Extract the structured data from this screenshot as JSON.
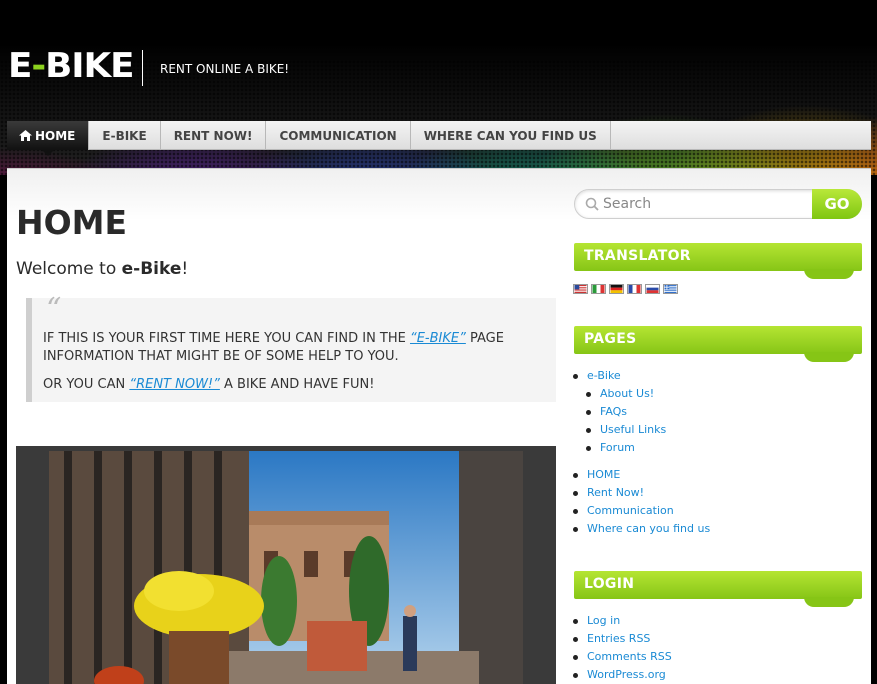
{
  "site": {
    "logo_part1": "E",
    "logo_dash": "-",
    "logo_part2": "BIKE",
    "tagline": "RENT ONLINE A BIKE!"
  },
  "nav": {
    "items": [
      {
        "label": "HOME",
        "active": true
      },
      {
        "label": "E-BIKE"
      },
      {
        "label": "RENT NOW!"
      },
      {
        "label": "COMMUNICATION"
      },
      {
        "label": "WHERE CAN YOU FIND US"
      }
    ]
  },
  "main": {
    "title": "HOME",
    "welcome_prefix": "Welcome to ",
    "welcome_brand": "e-Bike",
    "welcome_suffix": "!",
    "quote_mark": "“",
    "quote_p1_before": "IF THIS IS YOUR FIRST TIME HERE YOU CAN FIND IN THE ",
    "quote_p1_link": "“E-BIKE”",
    "quote_p1_after": " PAGE INFORMATION THAT MIGHT BE OF SOME HELP TO YOU.",
    "quote_p2_before": "OR YOU CAN ",
    "quote_p2_link": "“RENT NOW!”",
    "quote_p2_after": " A BIKE AND HAVE FUN!"
  },
  "sidebar": {
    "search_placeholder": "Search",
    "go_label": "GO",
    "translator_title": "TRANSLATOR",
    "pages_title": "PAGES",
    "pages": {
      "ebike": "e-Bike",
      "about": "About Us!",
      "faqs": "FAQs",
      "useful": "Useful Links",
      "forum": "Forum",
      "home": "HOME",
      "rent": "Rent Now!",
      "communication": "Communication",
      "where": "Where can you find us"
    },
    "login_title": "LOGIN",
    "login_links": {
      "login": "Log in",
      "entries": "Entries RSS",
      "comments": "Comments RSS",
      "wordpress": "WordPress.org"
    }
  },
  "colors": {
    "accent_green": "#86c516",
    "link_blue": "#1a8ad4"
  }
}
